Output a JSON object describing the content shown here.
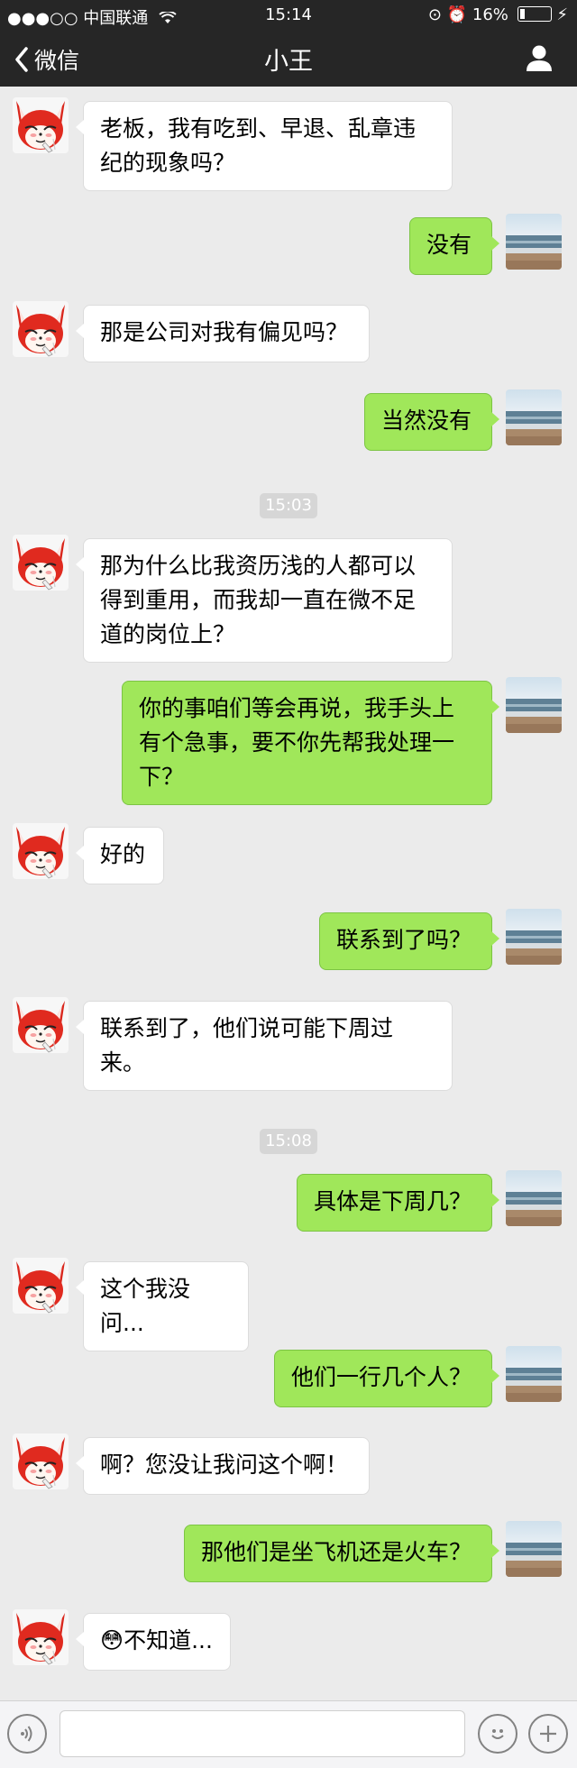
{
  "status_bar": {
    "signal": "●●●○○",
    "carrier": "中国联通",
    "time": "15:14",
    "battery_percent": "16%",
    "battery_level": 0.16
  },
  "nav": {
    "back_label": "微信",
    "title": "小王"
  },
  "timestamps": [
    "15:03",
    "15:08"
  ],
  "messages": [
    {
      "from": "left",
      "text": "老板，我有吃到、早退、乱章违纪的现象吗？"
    },
    {
      "from": "right",
      "text": "没有"
    },
    {
      "from": "left",
      "text": "那是公司对我有偏见吗？"
    },
    {
      "from": "right",
      "text": "当然没有"
    },
    {
      "from": "left",
      "text": "那为什么比我资历浅的人都可以得到重用，而我却一直在微不足道的岗位上？"
    },
    {
      "from": "right",
      "text": "你的事咱们等会再说，我手头上有个急事，要不你先帮我处理一下？"
    },
    {
      "from": "left",
      "text": "好的"
    },
    {
      "from": "right",
      "text": "联系到了吗？"
    },
    {
      "from": "left",
      "text": "联系到了，他们说可能下周过来。"
    },
    {
      "from": "right",
      "text": "具体是下周几？"
    },
    {
      "from": "left",
      "text": "这个我没问..."
    },
    {
      "from": "right",
      "text": "他们一行几个人？"
    },
    {
      "from": "left",
      "text": "啊？您没让我问这个啊！"
    },
    {
      "from": "right",
      "text": "那他们是坐飞机还是火车？"
    },
    {
      "from": "left",
      "emoji": "😳",
      "text": "不知道..."
    }
  ],
  "colors": {
    "background": "#ebebeb",
    "nav_bg": "#262626",
    "bubble_left": "#ffffff",
    "bubble_right": "#a0e75a"
  },
  "icons": {
    "back": "chevron-left-icon",
    "profile": "person-icon",
    "voice": "voice-icon",
    "emoji": "smiley-icon",
    "plus": "plus-icon",
    "left_avatar": "red-fox-avatar",
    "right_avatar": "beach-avatar"
  }
}
